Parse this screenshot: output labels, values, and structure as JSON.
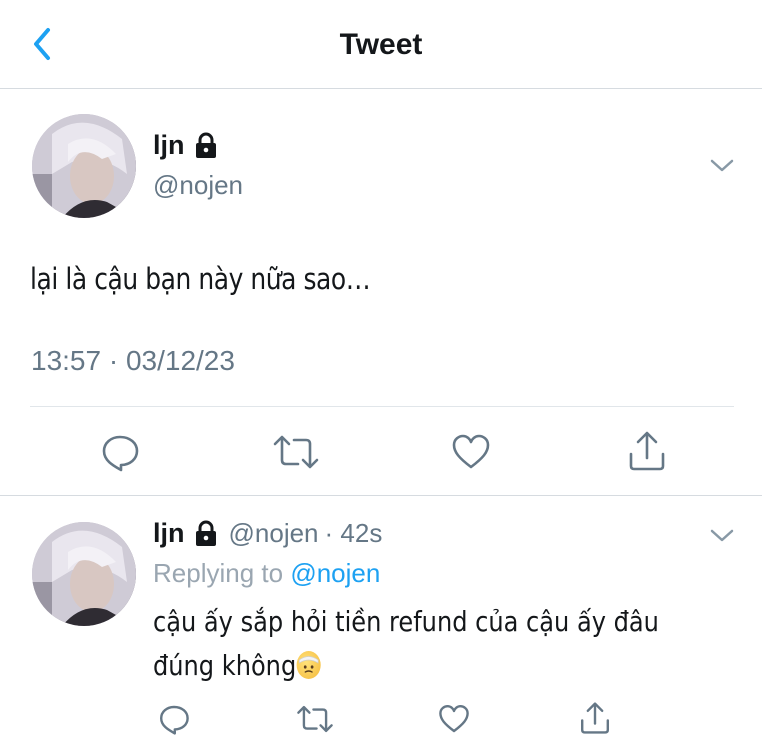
{
  "header": {
    "title": "Tweet"
  },
  "main_tweet": {
    "display_name": "ljn",
    "handle": "@nojen",
    "text": "lại là cậu bạn này nữa sao…",
    "timestamp": "13:57 · 03/12/23"
  },
  "reply_tweet": {
    "display_name": "ljn",
    "handle": "@nojen",
    "time_ago": "· 42s",
    "replying_prefix": "Replying to",
    "replying_to": "@nojen",
    "text": "cậu ấy sắp hỏi tiền refund của cậu ấy đâu đúng không",
    "emoji": "face-with-head-bandage"
  },
  "colors": {
    "accent": "#1da1f2",
    "muted": "#657786",
    "icon": "#657786"
  }
}
